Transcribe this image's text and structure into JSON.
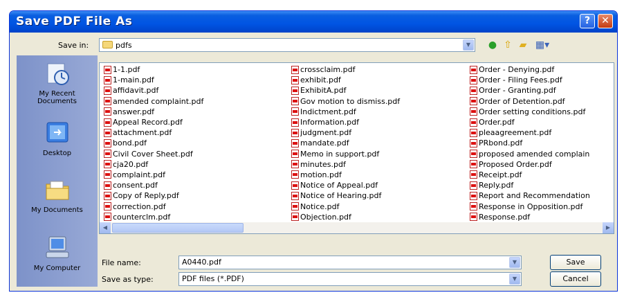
{
  "window": {
    "title": "Save PDF File As",
    "help_label": "?",
    "close_label": "✕"
  },
  "save_in": {
    "label": "Save in:",
    "value": "pdfs"
  },
  "places": [
    {
      "label": "My Recent\nDocuments",
      "icon": "recent-documents-icon"
    },
    {
      "label": "Desktop",
      "icon": "desktop-icon"
    },
    {
      "label": "My Documents",
      "icon": "my-documents-icon"
    },
    {
      "label": "My Computer",
      "icon": "my-computer-icon"
    }
  ],
  "files": {
    "column1": [
      "1-1.pdf",
      "1-main.pdf",
      "affidavit.pdf",
      "amended complaint.pdf",
      "answer.pdf",
      "Appeal Record.pdf",
      "attachment.pdf",
      "bond.pdf",
      "Civil Cover Sheet.pdf",
      "cja20.pdf",
      "complaint.pdf",
      "consent.pdf",
      "Copy of Reply.pdf",
      "correction.pdf",
      "counterclm.pdf"
    ],
    "column2": [
      "crossclaim.pdf",
      "exhibit.pdf",
      "ExhibitA.pdf",
      "Gov motion to dismiss.pdf",
      "Indictment.pdf",
      "Information.pdf",
      "judgment.pdf",
      "mandate.pdf",
      "Memo in support.pdf",
      "minutes.pdf",
      "motion.pdf",
      "Notice of Appeal.pdf",
      "Notice of Hearing.pdf",
      "Notice.pdf",
      "Objection.pdf"
    ],
    "column3": [
      "Order - Denying.pdf",
      "Order - Filing Fees.pdf",
      "Order - Granting.pdf",
      "Order of Detention.pdf",
      "Order setting conditions.pdf",
      "Order.pdf",
      "pleaagreement.pdf",
      "PRbond.pdf",
      "proposed amended complain",
      "Proposed Order.pdf",
      "Receipt.pdf",
      "Reply.pdf",
      "Report and Recommendation",
      "Response in Opposition.pdf",
      "Response.pdf"
    ]
  },
  "file_name": {
    "label": "File name:",
    "value": "A0440.pdf"
  },
  "save_as_type": {
    "label": "Save as type:",
    "value": "PDF files (*.PDF)"
  },
  "buttons": {
    "save": "Save",
    "cancel": "Cancel"
  },
  "scroll_left": "◀",
  "scroll_right": "▶",
  "dropdown_arrow": "▼",
  "colors": {
    "titlebar": "#0054e3",
    "dialog_bg": "#ece9d8",
    "places_bar": "#8a9dcf",
    "pdf_red": "#d11111"
  }
}
